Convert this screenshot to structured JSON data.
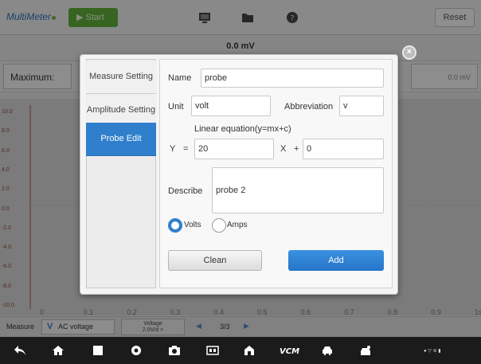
{
  "topbar": {
    "app_title": "MultiMeter",
    "start_label": "Start",
    "reset_label": "Reset",
    "icons": [
      "monitor-icon",
      "folder-icon",
      "help-icon"
    ]
  },
  "reading": "0.0 mV",
  "stats": {
    "maximum_label": "Maximum:",
    "right_value": "0.0 mV"
  },
  "graph": {
    "y_ticks": [
      "10.0",
      "8.0",
      "6.0",
      "4.0",
      "2.0",
      "0.0",
      "-2.0",
      "-4.0",
      "-6.0",
      "-8.0",
      "-10.0"
    ],
    "x_ticks": [
      "0",
      "0.1",
      "0.2",
      "0.3",
      "0.4",
      "0.5",
      "0.6",
      "0.7",
      "0.8",
      "0.9",
      "1s"
    ]
  },
  "infobar": {
    "measure_label": "Measure",
    "ac_voltage_label": "AC voltage",
    "voltage_line1": "Voltage",
    "voltage_line2": "2.0V/d >",
    "page_text": "3/3"
  },
  "dialog": {
    "tabs": [
      {
        "label": "Measure Setting",
        "active": false
      },
      {
        "label": "Amplitude Setting",
        "active": false
      },
      {
        "label": "Probe Edit",
        "active": true
      }
    ],
    "name_label": "Name",
    "name_value": "probe",
    "unit_label": "Unit",
    "unit_value": "volt",
    "abbreviation_label": "Abbreviation",
    "abbreviation_value": "v",
    "equation_label": "Linear equation(y=mx+c)",
    "y_label": "Y",
    "equals": "=",
    "m_value": "20",
    "x_label": "X",
    "plus": "+",
    "c_value": "0",
    "describe_label": "Describe",
    "describe_value": "probe 2",
    "radio_volts": "Volts",
    "radio_amps": "Amps",
    "selected_radio": "Volts",
    "clean_label": "Clean",
    "add_label": "Add"
  },
  "colors": {
    "accent": "#2f7fcc",
    "start_green": "#5fae3a"
  }
}
